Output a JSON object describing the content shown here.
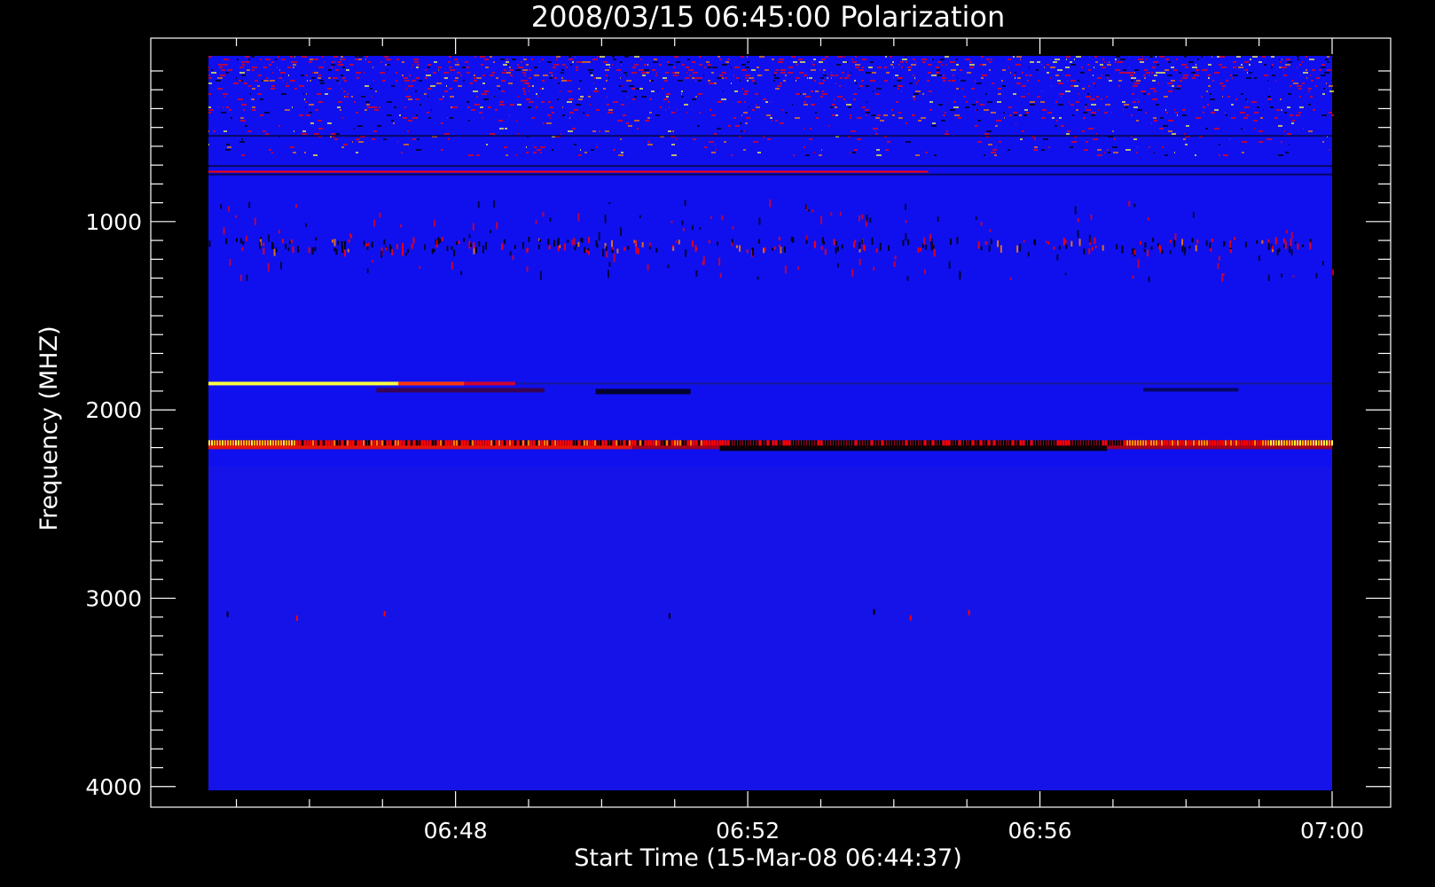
{
  "chart_data": {
    "type": "heatmap",
    "title": "2008/03/15 06:45:00 Polarization",
    "xlabel": "Start Time (15-Mar-08 06:44:37)",
    "ylabel": "Frequency (MHZ)",
    "x_ticks": [
      {
        "label": "06:48",
        "minutes": 3.383
      },
      {
        "label": "06:52",
        "minutes": 7.383
      },
      {
        "label": "06:56",
        "minutes": 11.383
      },
      {
        "label": "07:00",
        "minutes": 15.383
      }
    ],
    "x_range_minutes": [
      0,
      15.383
    ],
    "y_ticks": [
      1000,
      2000,
      3000,
      4000
    ],
    "ylim": [
      120,
      4020
    ],
    "y_inverted": true,
    "colors": {
      "background": "#0000ff",
      "low": "#000000",
      "mid": "#ff0000",
      "high": "#ffff40"
    },
    "features": [
      {
        "name": "rfi-band-top",
        "freq_from": 120,
        "freq_to": 650,
        "level": "noisy"
      },
      {
        "name": "rfi-line-a",
        "freq": 735,
        "level": "red"
      },
      {
        "name": "rfi-speckle-band",
        "freq_from": 1080,
        "freq_to": 1150,
        "level": "speckle"
      },
      {
        "name": "band-1860",
        "freq": 1860,
        "time_from": 0,
        "time_to": 3.5,
        "level": "bright"
      },
      {
        "name": "band-2180",
        "freq": 2180,
        "time_from": 0,
        "time_to": 15.383,
        "level": "bright-to-red"
      }
    ]
  }
}
